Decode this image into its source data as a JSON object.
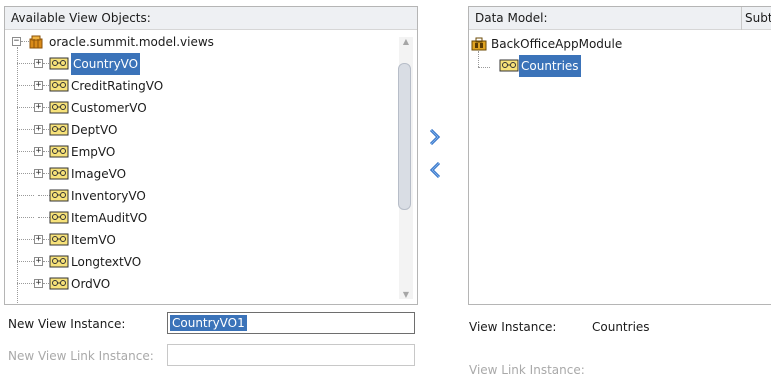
{
  "left_panel": {
    "header": "Available View Objects:",
    "root_label": "oracle.summit.model.views",
    "items": [
      {
        "label": "CountryVO",
        "expandable": true,
        "selected": true
      },
      {
        "label": "CreditRatingVO",
        "expandable": true
      },
      {
        "label": "CustomerVO",
        "expandable": true
      },
      {
        "label": "DeptVO",
        "expandable": true
      },
      {
        "label": "EmpVO",
        "expandable": true
      },
      {
        "label": "ImageVO",
        "expandable": true
      },
      {
        "label": "InventoryVO",
        "expandable": false
      },
      {
        "label": "ItemAuditVO",
        "expandable": false
      },
      {
        "label": "ItemVO",
        "expandable": true
      },
      {
        "label": "LongtextVO",
        "expandable": true
      },
      {
        "label": "OrdVO",
        "expandable": true
      }
    ]
  },
  "shuttle": {
    "add_icon": "chevron-right-icon",
    "remove_icon": "chevron-left-icon",
    "color": "#2f6fc4"
  },
  "right_panel": {
    "header": "Data Model:",
    "column2_header": "Subt",
    "root_label": "BackOfficeAppModule",
    "child_label": "Countries"
  },
  "form": {
    "new_view_instance_label": "New View Instance:",
    "new_view_instance_value": "CountryVO1",
    "new_view_link_instance_label": "New View Link Instance:",
    "new_view_link_instance_value": "",
    "view_instance_label": "View Instance:",
    "view_instance_value": "Countries",
    "view_link_instance_label": "View Link Instance:"
  },
  "colors": {
    "selection": "#3b73b9",
    "header_bg": "#eef0f3"
  }
}
